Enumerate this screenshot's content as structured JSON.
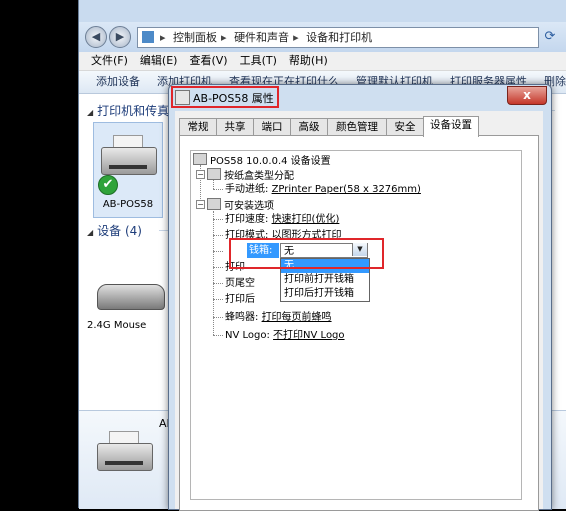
{
  "explorer": {
    "breadcrumb": [
      "控制面板",
      "硬件和声音",
      "设备和打印机"
    ],
    "menu": [
      "文件(F)",
      "编辑(E)",
      "查看(V)",
      "工具(T)",
      "帮助(H)"
    ],
    "toolbar": [
      "添加设备",
      "添加打印机",
      "查看现在正在打印什么",
      "管理默认打印机",
      "打印服务器属性",
      "删除设备"
    ],
    "section_printers": "打印机和传真",
    "printer_name": "AB-POS58",
    "section_devices": "设备 (4)",
    "mouse_name": "2.4G Mouse",
    "details_name": "AB"
  },
  "dialog": {
    "title": "AB-POS58 属性",
    "close_label": "x",
    "tabs": [
      "常规",
      "共享",
      "端口",
      "高级",
      "颜色管理",
      "安全",
      "设备设置"
    ],
    "active_tab": "设备设置",
    "tree": {
      "root": "POS58 10.0.0.4 设备设置",
      "paper_group": "按纸盒类型分配",
      "manual_feed_label": "手动进纸:",
      "manual_feed_value": "ZPrinter Paper(58 x 3276mm)",
      "options_group": "可安装选项",
      "print_speed_label": "打印速度:",
      "print_speed_value": "快速打印(优化)",
      "print_mode_label": "打印模式:",
      "print_mode_value": "以图形方式打印",
      "cash_drawer_label": "钱箱:",
      "cash_drawer_value": "无",
      "hidden_row_1": "打印",
      "hidden_row_2": "页尾空",
      "hidden_row_3": "打印后",
      "buzzer_label": "蜂鸣器:",
      "buzzer_value": "打印每页前蜂鸣",
      "nv_logo_label": "NV Logo:",
      "nv_logo_value": "不打印NV Logo"
    },
    "cash_drawer_options": [
      "无",
      "打印前打开钱箱",
      "打印后打开钱箱"
    ],
    "cash_drawer_selected_index": 0
  },
  "colors": {
    "highlight_red": "#e0262a",
    "selection_blue": "#3399ff"
  }
}
